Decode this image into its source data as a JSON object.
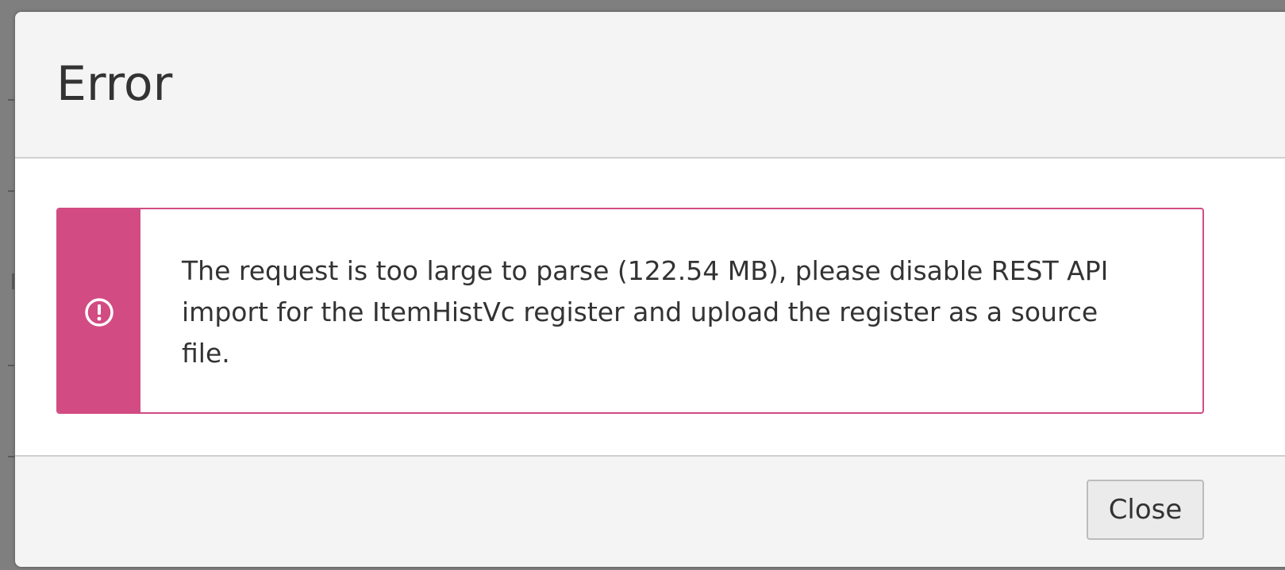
{
  "dialog": {
    "title": "Error",
    "alert": {
      "severity": "error",
      "icon": "exclamation-circle-icon",
      "accent_color": "#d24b83",
      "message": "The request is too large to parse (122.54 MB), please disable REST API import for the ItemHistVc register and upload the register as a source file."
    },
    "footer": {
      "close_label": "Close"
    }
  }
}
